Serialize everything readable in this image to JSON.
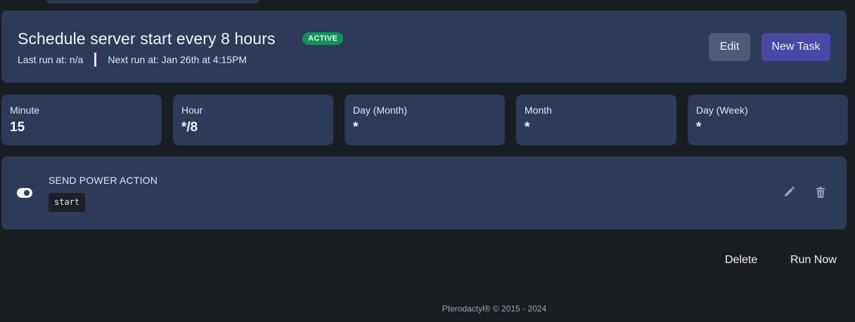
{
  "schedule": {
    "title": "Schedule server start every 8 hours",
    "status_badge": "ACTIVE",
    "last_run": "Last run at: n/a",
    "next_run": "Next run at: Jan 26th at 4:15PM",
    "edit_label": "Edit",
    "new_task_label": "New Task"
  },
  "cron": [
    {
      "label": "Minute",
      "value": "15"
    },
    {
      "label": "Hour",
      "value": "*/8"
    },
    {
      "label": "Day (Month)",
      "value": "*"
    },
    {
      "label": "Month",
      "value": "*"
    },
    {
      "label": "Day (Week)",
      "value": "*"
    }
  ],
  "task": {
    "title": "SEND POWER ACTION",
    "payload": "start",
    "icons": {
      "toggle": "toggle-icon",
      "edit": "pencil-icon",
      "delete": "trash-icon"
    }
  },
  "actions": {
    "delete_label": "Delete",
    "run_now_label": "Run Now"
  },
  "footer": {
    "text": "Pterodactyl® © 2015 - 2024"
  },
  "colors": {
    "background": "#1a1d21",
    "card": "#2e3a59",
    "badge": "#14905a",
    "primary_button": "#4a47a6",
    "secondary_button": "#4e5a78"
  }
}
